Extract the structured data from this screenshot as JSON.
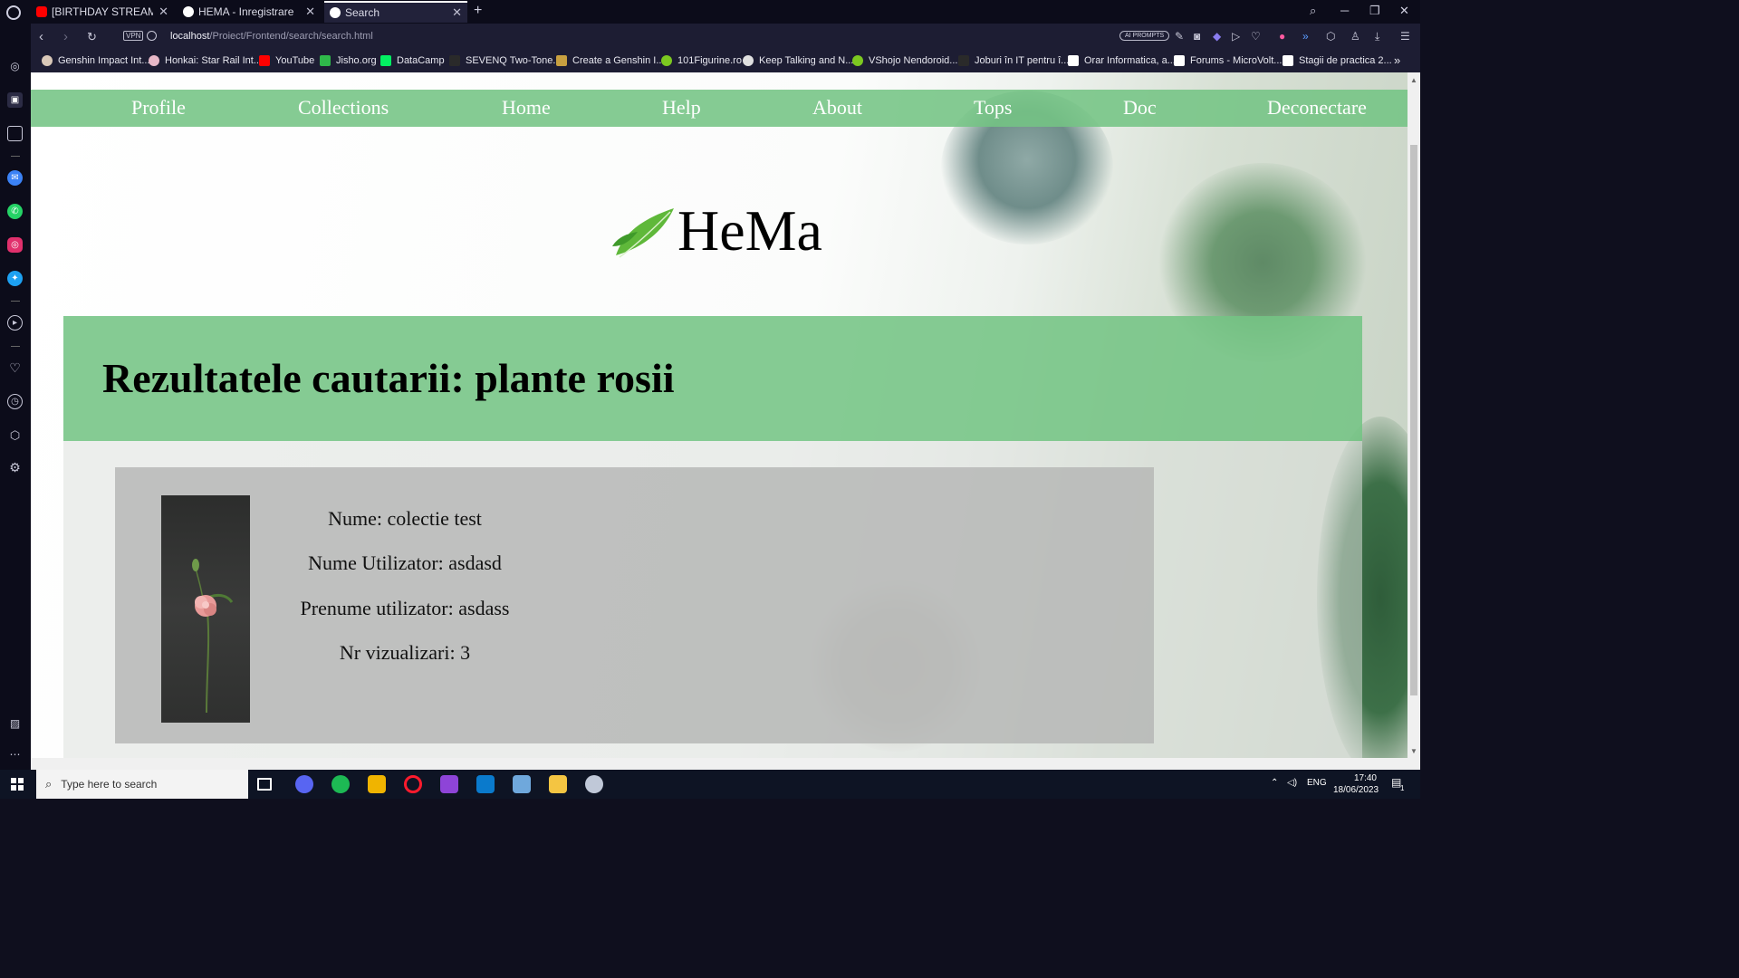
{
  "browser": {
    "tabs": [
      {
        "title": "[BIRTHDAY STREAM]Let's",
        "favicon": "youtube-icon",
        "color": "#ff0000"
      },
      {
        "title": "HEMA - Inregistrare",
        "favicon": "globe-icon",
        "color": "#ffffff"
      },
      {
        "title": "Search",
        "favicon": "globe-icon",
        "color": "#ffffff",
        "active": true
      }
    ],
    "url": {
      "host": "localhost",
      "path": "/Proiect/Frontend/search/search.html"
    },
    "vpn_label": "VPN",
    "ai_prompts_label": "AI PROMPTS",
    "bookmarks": [
      {
        "label": "Genshin Impact Int...",
        "color": "#d9c8b8"
      },
      {
        "label": "Honkai: Star Rail Int...",
        "color": "#e8b8c8"
      },
      {
        "label": "YouTube",
        "color": "#ff0000"
      },
      {
        "label": "Jisho.org",
        "color": "#2fb84a"
      },
      {
        "label": "DataCamp",
        "color": "#03ef62"
      },
      {
        "label": "SEVENQ Two-Tone...",
        "color": "#2a2a2a"
      },
      {
        "label": "Create a Genshin I...",
        "color": "#c8a040"
      },
      {
        "label": "101Figurine.ro",
        "color": "#7cc820"
      },
      {
        "label": "Keep Talking and N...",
        "color": "#e0e0e0"
      },
      {
        "label": "VShojo Nendoroid...",
        "color": "#7cc820"
      },
      {
        "label": "Joburi în IT pentru î...",
        "color": "#2a2a2a"
      },
      {
        "label": "Orar Informatica, a...",
        "color": "#ffffff"
      },
      {
        "label": "Forums - MicroVolt...",
        "color": "#ffffff"
      },
      {
        "label": "Stagii de practica 2...",
        "color": "#ffffff"
      }
    ]
  },
  "site": {
    "nav": [
      "Profile",
      "Collections",
      "Home",
      "Help",
      "About",
      "Tops",
      "Doc",
      "Deconectare"
    ],
    "brand": "HeMa",
    "results_title": "Rezultatele cautarii: plante rosii",
    "results": [
      {
        "image": "flower-photo",
        "nume": "Nume: colectie test",
        "nume_utilizator": "Nume Utilizator: asdasd",
        "prenume_utilizator": "Prenume utilizator: asdass",
        "vizualizari": "Nr vizualizari: 3"
      }
    ],
    "accent_color": "#74c484"
  },
  "taskbar": {
    "search_placeholder": "Type here to search",
    "language": "ENG",
    "time": "17:40",
    "date": "18/06/2023",
    "notification_count": "1"
  }
}
